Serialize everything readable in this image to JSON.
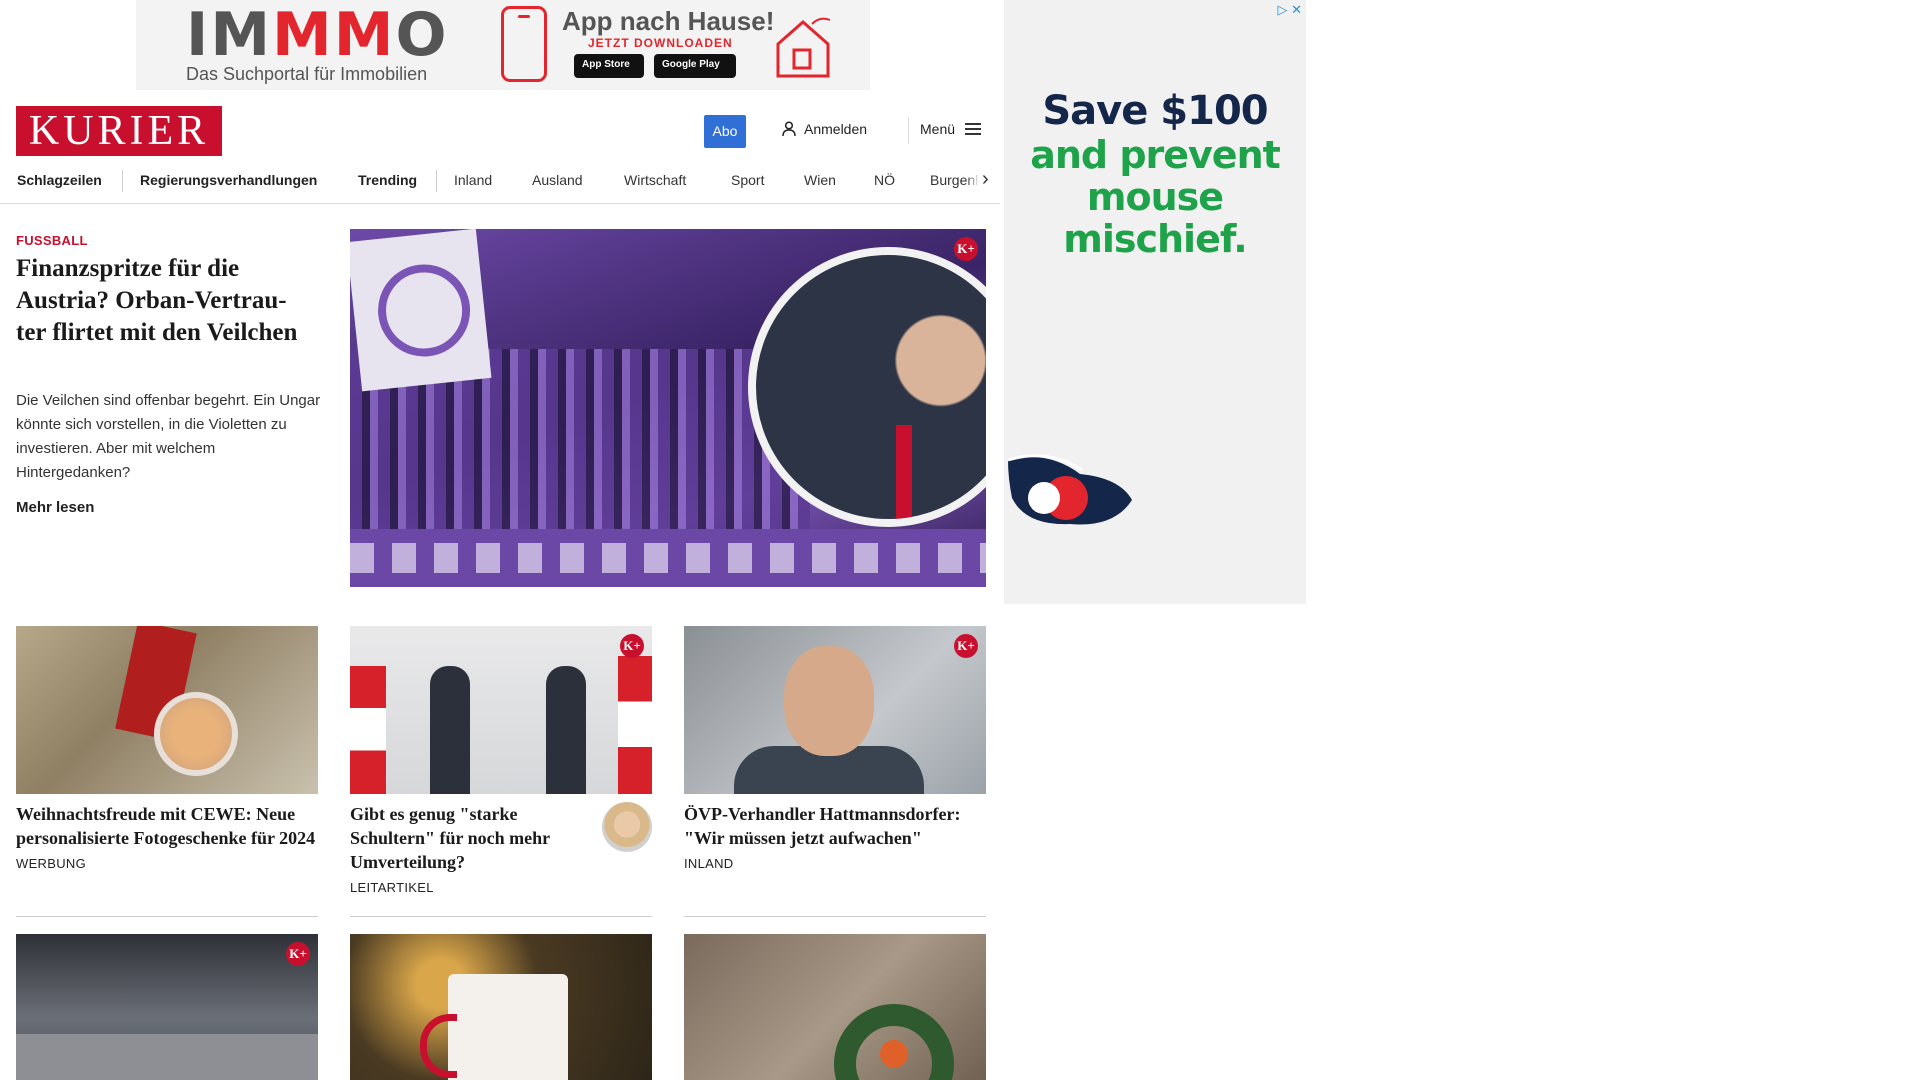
{
  "top_ad": {
    "brand_prefix": "IM",
    "brand_mid": "MM",
    "brand_suffix": "O",
    "tagline": "Das Suchportal für Immobilien",
    "headline": "App nach Hause!",
    "cta": "JETZT DOWNLOADEN",
    "app_store": "App Store",
    "google_play": "Google Play"
  },
  "right_ad": {
    "line1": "Save $100",
    "line2": "and prevent mouse mischief.",
    "adchoices": "▷ ✕"
  },
  "header": {
    "logo": "KURIER",
    "abo": "Abo",
    "login": "Anmelden",
    "menu": "Menü"
  },
  "nav": {
    "items": [
      "Schlagzeilen",
      "Regierungsverhandlungen",
      "Trending",
      "Inland",
      "Ausland",
      "Wirtschaft",
      "Sport",
      "Wien",
      "NÖ",
      "Burgenland"
    ]
  },
  "hero": {
    "kicker": "FUSSBALL",
    "title": "Finanzspritze für die Austria? Orban-Vertrau-ter flirtet mit den Veilchen",
    "lead": "Die Veilchen sind offenbar begehrt. Ein Ungar könnte sich vorstellen, in die Violetten zu investieren. Aber mit welchem Hintergedanken?",
    "more": "Mehr lesen",
    "premium": "K+"
  },
  "cards": [
    {
      "title": "Weihnachtsfreude mit CEWE: Neue personalisierte Fotogeschenke für 2024",
      "tag": "WERBUNG"
    },
    {
      "title": "Gibt es genug \"starke Schultern\" für noch mehr Umverteilung?",
      "tag": "LEITARTIKEL",
      "premium": "K+"
    },
    {
      "title": "ÖVP-Verhandler Hattmannsdorfer: \"Wir müssen jetzt aufwachen\"",
      "tag": "INLAND",
      "premium": "K+"
    },
    {
      "premium": "K+"
    }
  ],
  "colors": {
    "brand_red": "#c8102e",
    "abo_blue": "#2f6fd6",
    "ad_green": "#1fa34a",
    "ad_navy": "#14264a"
  }
}
